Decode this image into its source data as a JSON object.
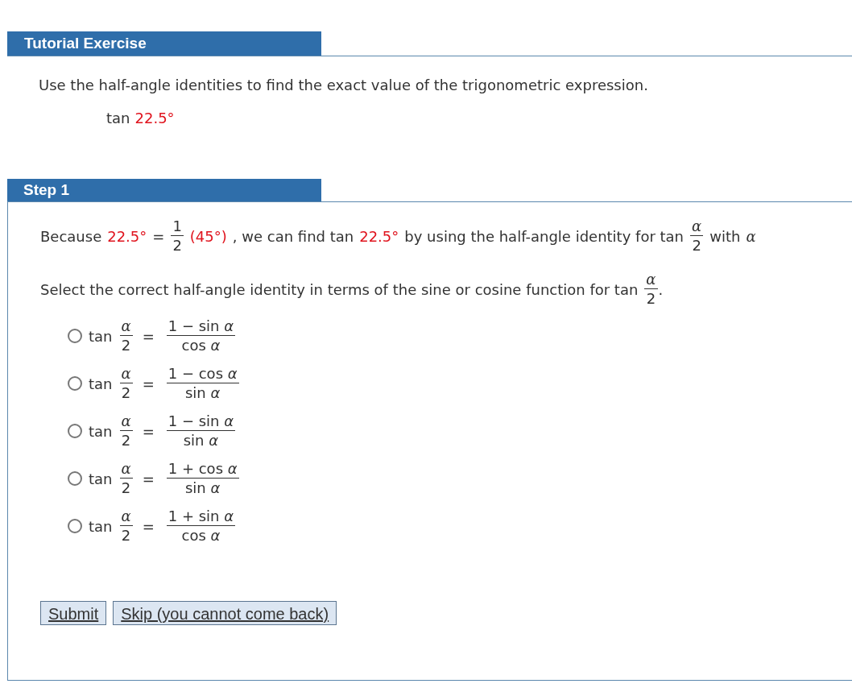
{
  "header": {
    "title": "Tutorial Exercise"
  },
  "intro": "Use the half-angle identities to find the exact value of the trigonometric expression.",
  "expression": {
    "func": "tan",
    "angle": "22.5°"
  },
  "step": {
    "title": "Step 1",
    "sentence": [
      {
        "kind": "text",
        "text": "Because"
      },
      {
        "kind": "value",
        "text": "22.5°"
      },
      {
        "kind": "text",
        "text": "="
      },
      {
        "kind": "fraction",
        "num": "1",
        "den": "2"
      },
      {
        "kind": "value",
        "text": "(45°)"
      },
      {
        "kind": "text",
        "text": ", we can find tan"
      },
      {
        "kind": "value",
        "text": "22.5°"
      },
      {
        "kind": "text",
        "text": "by using the half-angle identity for tan"
      },
      {
        "kind": "fraction",
        "num": "α",
        "den": "2"
      },
      {
        "kind": "text",
        "text": "with"
      },
      {
        "kind": "symbol",
        "text": "α"
      }
    ],
    "prompt": {
      "text": "Select the correct half-angle identity in terms of the sine or cosine function for tan",
      "num": "α",
      "den": "2",
      "end": "."
    },
    "options": [
      {
        "selected": false,
        "func": "tan",
        "lnum": "α",
        "lden": "2",
        "eq": "=",
        "num": "1 − sin *α*",
        "den": "cos *α*"
      },
      {
        "selected": false,
        "func": "tan",
        "lnum": "α",
        "lden": "2",
        "eq": "=",
        "num": "1 − cos *α*",
        "den": "sin *α*"
      },
      {
        "selected": false,
        "func": "tan",
        "lnum": "α",
        "lden": "2",
        "eq": "=",
        "num": "1 − sin *α*",
        "den": "sin *α*"
      },
      {
        "selected": false,
        "func": "tan",
        "lnum": "α",
        "lden": "2",
        "eq": "=",
        "num": "1 + cos *α*",
        "den": "sin *α*"
      },
      {
        "selected": false,
        "func": "tan",
        "lnum": "α",
        "lden": "2",
        "eq": "=",
        "num": "1 + sin *α*",
        "den": "cos *α*"
      }
    ],
    "buttons": [
      "Submit",
      "Skip (you cannot come back)"
    ]
  }
}
